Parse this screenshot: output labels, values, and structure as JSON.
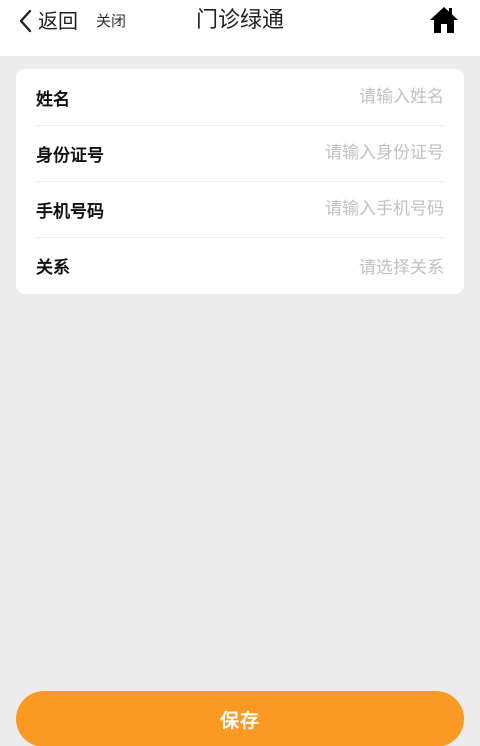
{
  "nav": {
    "back_label": "返回",
    "close_label": "关闭",
    "title": "门诊绿通",
    "home_icon": "home-icon",
    "back_icon": "chevron-left-icon"
  },
  "form": {
    "fields": [
      {
        "label": "姓名",
        "placeholder": "请输入姓名",
        "type": "text"
      },
      {
        "label": "身份证号",
        "placeholder": "请输入身份证号",
        "type": "text"
      },
      {
        "label": "手机号码",
        "placeholder": "请输入手机号码",
        "type": "tel"
      },
      {
        "label": "关系",
        "placeholder": "请选择关系",
        "type": "select"
      }
    ]
  },
  "actions": {
    "save_label": "保存"
  },
  "colors": {
    "page_background": "#ececec",
    "accent": "#fb9a22",
    "placeholder": "#c2c2c2"
  }
}
